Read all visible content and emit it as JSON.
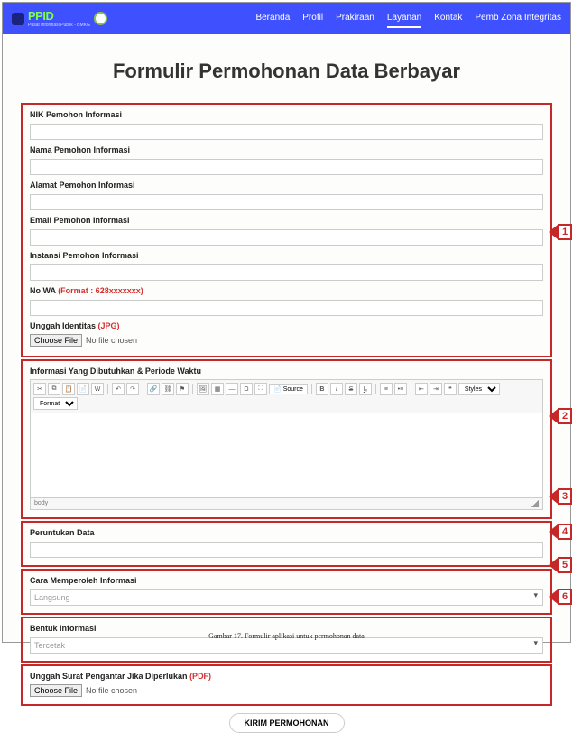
{
  "nav": {
    "brand_text": "PPID",
    "brand_sub": "Pusat Informasi Publik - BMKG",
    "links": [
      "Beranda",
      "Profil",
      "Prakiraan",
      "Layanan",
      "Kontak",
      "Pemb Zona Integritas"
    ],
    "active_index": 3
  },
  "title": "Formulir Permohonan Data Berbayar",
  "section1": {
    "nik_label": "NIK Pemohon Informasi",
    "nama_label": "Nama Pemohon Informasi",
    "alamat_label": "Alamat Pemohon Informasi",
    "email_label": "Email Pemohon Informasi",
    "instansi_label": "Instansi Pemohon Informasi",
    "wa_label": "No WA",
    "wa_hint": "(Format : 628xxxxxxx)",
    "unggah_id_label": "Unggah Identitas",
    "unggah_id_hint": "(JPG)",
    "choose_file": "Choose File",
    "no_file": "No file chosen"
  },
  "section2": {
    "label": "Informasi Yang Dibutuhkan & Periode Waktu",
    "source": "Source",
    "styles": "Styles",
    "format": "Format",
    "footer": "body"
  },
  "section3": {
    "label": "Peruntukan Data"
  },
  "section4": {
    "label": "Cara Memperoleh Informasi",
    "value": "Langsung"
  },
  "section5": {
    "label": "Bentuk Informasi",
    "value": "Tercetak"
  },
  "section6": {
    "label": "Unggah Surat Pengantar Jika Diperlukan",
    "hint": "(PDF)",
    "choose_file": "Choose File",
    "no_file": "No file chosen"
  },
  "submit": "KIRIM PERMOHONAN",
  "annotations": [
    "1",
    "2",
    "3",
    "4",
    "5",
    "6"
  ],
  "caption": "Gambar 17. Formulir aplikasi untuk permohonan data"
}
